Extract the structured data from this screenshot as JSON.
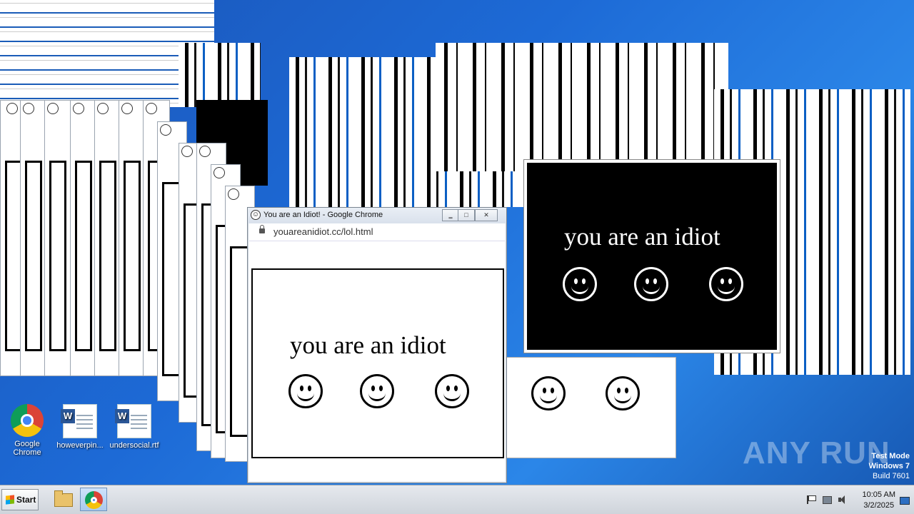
{
  "desktop": {
    "icons": [
      {
        "label": "Google Chrome",
        "icon": "chrome-icon"
      },
      {
        "label": "howeverpin...",
        "icon": "word-document-icon"
      },
      {
        "label": "undersocial.rtf",
        "icon": "word-document-icon"
      }
    ],
    "watermark": "ANY RUN",
    "test_mode": {
      "line1": "Test Mode",
      "line2": "Windows 7",
      "line3": "Build 7601"
    }
  },
  "popup": {
    "title": "You are an Idiot! - Google Chrome",
    "url": "youareanidiot.cc/lol.html",
    "message": "you are an idiot",
    "buttons": {
      "minimize": "‗",
      "maximize": "□",
      "close": "✕"
    }
  },
  "black_popup": {
    "message": "you are an idiot"
  },
  "taskbar": {
    "start_label": "Start",
    "apps": [
      {
        "name": "File Explorer",
        "icon": "folder-icon"
      },
      {
        "name": "Google Chrome",
        "icon": "chrome-icon",
        "active": true
      }
    ],
    "clock": {
      "time": "10:05 AM",
      "date": "3/2/2025"
    },
    "tray_icons": [
      "flag-icon",
      "network-icon",
      "volume-icon",
      "show-desktop-icon"
    ]
  }
}
